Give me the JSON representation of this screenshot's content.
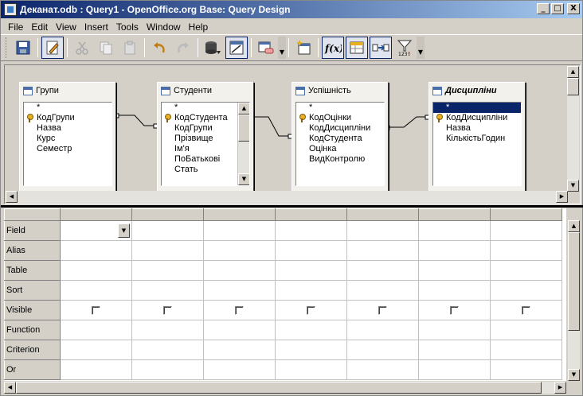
{
  "window": {
    "title": "Деканат.odb : Query1 - OpenOffice.org Base: Query Design",
    "minimize_label": "_",
    "maximize_label": "□",
    "close_label": "X"
  },
  "menu": [
    "File",
    "Edit",
    "View",
    "Insert",
    "Tools",
    "Window",
    "Help"
  ],
  "toolbar": {
    "buttons": [
      "save-icon",
      "edit-mode-icon",
      "cut-icon",
      "copy-icon",
      "paste-icon",
      "undo-icon",
      "redo-icon",
      "run-query-icon",
      "design-view-icon",
      "add-table-icon",
      "new-relation-icon",
      "functions-icon",
      "table-name-icon",
      "alias-icon",
      "distinct-values-icon"
    ]
  },
  "tables": [
    {
      "name": "Групи",
      "fields": [
        "*",
        "КодГрупи",
        "Назва",
        "Курс",
        "Семестр"
      ],
      "key": "КодГрупи",
      "selected": false
    },
    {
      "name": "Студенти",
      "fields": [
        "*",
        "КодСтудента",
        "КодГрупи",
        "Прізвище",
        "Ім'я",
        "ПоБатькові",
        "Стать"
      ],
      "key": "КодСтудента",
      "selected": false
    },
    {
      "name": "Успішність",
      "fields": [
        "*",
        "КодОцінки",
        "КодДисципліни",
        "КодСтудента",
        "Оцінка",
        "ВидКонтролю"
      ],
      "key": "КодОцінки",
      "selected": false
    },
    {
      "name": "Дисципліни",
      "fields": [
        "*",
        "КодДисципліни",
        "Назва",
        "КількістьГодин"
      ],
      "key": "КодДисципліни",
      "selected": true
    }
  ],
  "grid": {
    "row_labels": [
      "Field",
      "Alias",
      "Table",
      "Sort",
      "Visible",
      "Function",
      "Criterion",
      "Or"
    ],
    "column_count": 7,
    "visible": [
      false,
      false,
      false,
      false,
      false,
      false,
      false
    ]
  }
}
